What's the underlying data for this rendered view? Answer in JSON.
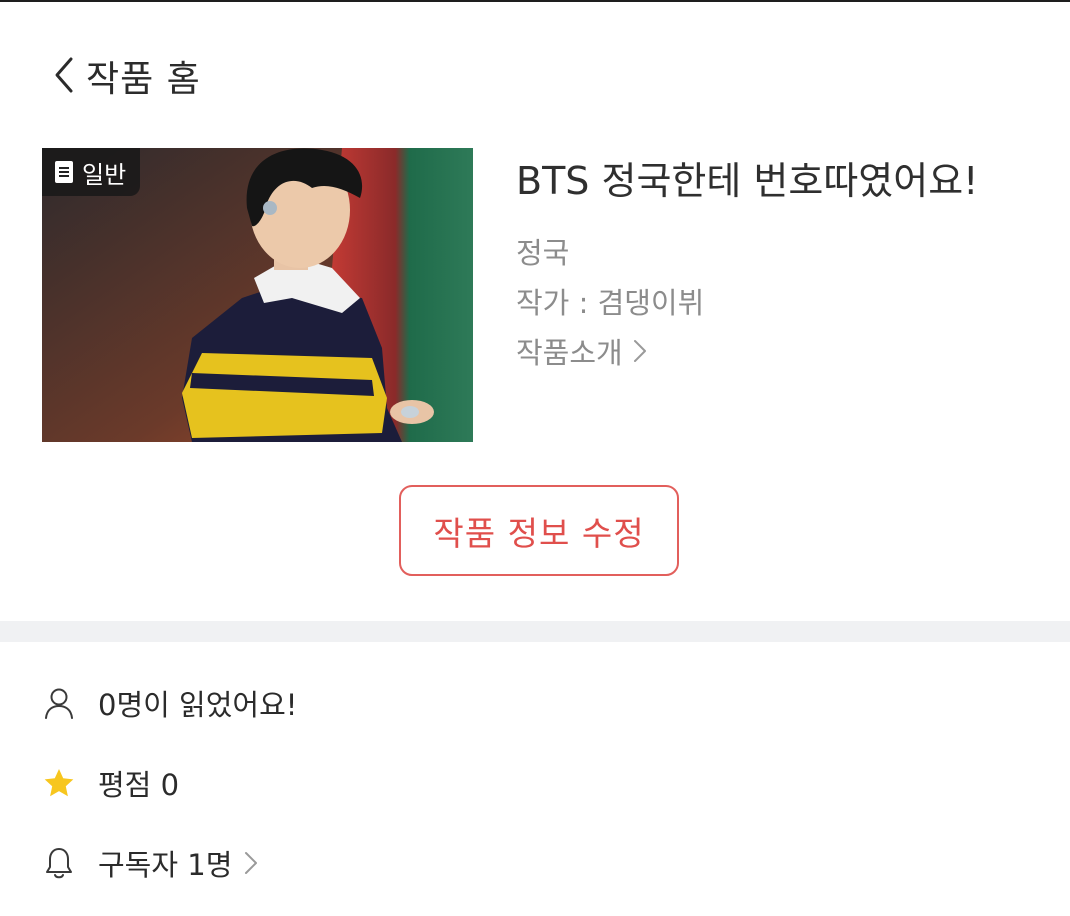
{
  "header": {
    "title": "작품 홈"
  },
  "work": {
    "genre_badge": "일반",
    "title": "BTS 정국한테 번호따였어요!",
    "tag": "정국",
    "author": "작가 : 겸댕이뷔",
    "intro_link": "작품소개"
  },
  "actions": {
    "edit_label": "작품 정보 수정"
  },
  "stats": {
    "readers": "0명이 읽었어요!",
    "rating": "평점 0",
    "subscribers": "구독자 1명"
  },
  "colors": {
    "accent": "#e25f5c",
    "star": "#f7c61e",
    "divider": "#f0f1f3",
    "meta_text": "#8c8c8c"
  },
  "icons": {
    "back": "chevron-left-icon",
    "badge": "document-icon",
    "intro": "chevron-right-icon",
    "readers": "person-icon",
    "rating": "star-icon",
    "subscribers": "bell-icon"
  }
}
